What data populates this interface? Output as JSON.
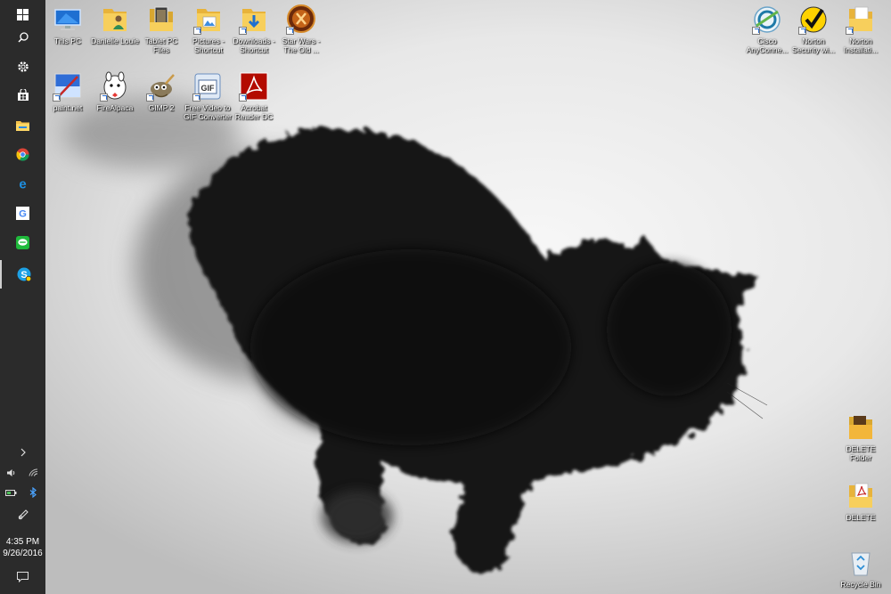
{
  "taskbar": {
    "items": [
      {
        "name": "start",
        "icon": "windows-icon"
      },
      {
        "name": "search",
        "icon": "search-icon"
      },
      {
        "name": "settings",
        "icon": "gear-icon"
      },
      {
        "name": "store",
        "icon": "store-icon"
      },
      {
        "name": "file-explorer",
        "icon": "folder-icon"
      },
      {
        "name": "chrome",
        "icon": "chrome-icon"
      },
      {
        "name": "edge",
        "icon": "edge-icon"
      },
      {
        "name": "google",
        "icon": "google-icon"
      },
      {
        "name": "line",
        "icon": "line-icon"
      },
      {
        "name": "skype",
        "icon": "skype-icon",
        "active": true
      }
    ],
    "tray": {
      "expand_icon": "chevron-right-icon",
      "volume_icon": "speaker-icon",
      "wifi_icon": "wifi-icon",
      "battery_icon": "battery-icon",
      "bluetooth_icon": "bluetooth-icon",
      "pen_icon": "pen-icon",
      "time": "4:35 PM",
      "date": "9/26/2016",
      "notifications_icon": "action-center-icon"
    }
  },
  "desktop": {
    "icons": [
      {
        "id": "this-pc",
        "label": "This PC",
        "icon": "computer-icon",
        "shortcut": false
      },
      {
        "id": "danielle-louie",
        "label": "Danielle Louie",
        "icon": "user-folder-icon",
        "shortcut": false
      },
      {
        "id": "tablet-pc-files",
        "label": "Tablet PC Files",
        "icon": "folder-icon",
        "shortcut": false
      },
      {
        "id": "pictures",
        "label": "Pictures - Shortcut",
        "icon": "pictures-folder-icon",
        "shortcut": true
      },
      {
        "id": "downloads",
        "label": "Downloads - Shortcut",
        "icon": "downloads-folder-icon",
        "shortcut": true
      },
      {
        "id": "star-wars",
        "label": "Star Wars - The Old ...",
        "icon": "star-wars-icon",
        "shortcut": true
      },
      {
        "id": "paintnet",
        "label": "paint.net",
        "icon": "paintnet-icon",
        "shortcut": true
      },
      {
        "id": "firealpaca",
        "label": "FireAlpaca",
        "icon": "firealpaca-icon",
        "shortcut": true
      },
      {
        "id": "gimp",
        "label": "GIMP 2",
        "icon": "gimp-icon",
        "shortcut": true
      },
      {
        "id": "video-to-gif",
        "label": "Free Video to GIF Converter",
        "icon": "gif-icon",
        "shortcut": true
      },
      {
        "id": "acrobat",
        "label": "Acrobat Reader DC",
        "icon": "acrobat-icon",
        "shortcut": true
      },
      {
        "id": "cisco",
        "label": "Cisco AnyConne...",
        "icon": "cisco-icon",
        "shortcut": true
      },
      {
        "id": "norton-security",
        "label": "Norton Security wi...",
        "icon": "norton-icon",
        "shortcut": true
      },
      {
        "id": "norton-install",
        "label": "Norton Installati...",
        "icon": "document-folder-icon",
        "shortcut": true
      },
      {
        "id": "delete-folder",
        "label": "DELETE Folder",
        "icon": "folder-icon",
        "shortcut": false
      },
      {
        "id": "delete",
        "label": "DELETE",
        "icon": "pdf-folder-icon",
        "shortcut": false
      },
      {
        "id": "recycle-bin",
        "label": "Recycle Bin",
        "icon": "recycle-bin-icon",
        "shortcut": false
      }
    ]
  },
  "wallpaper": {
    "subject": "black ink cat painting"
  }
}
